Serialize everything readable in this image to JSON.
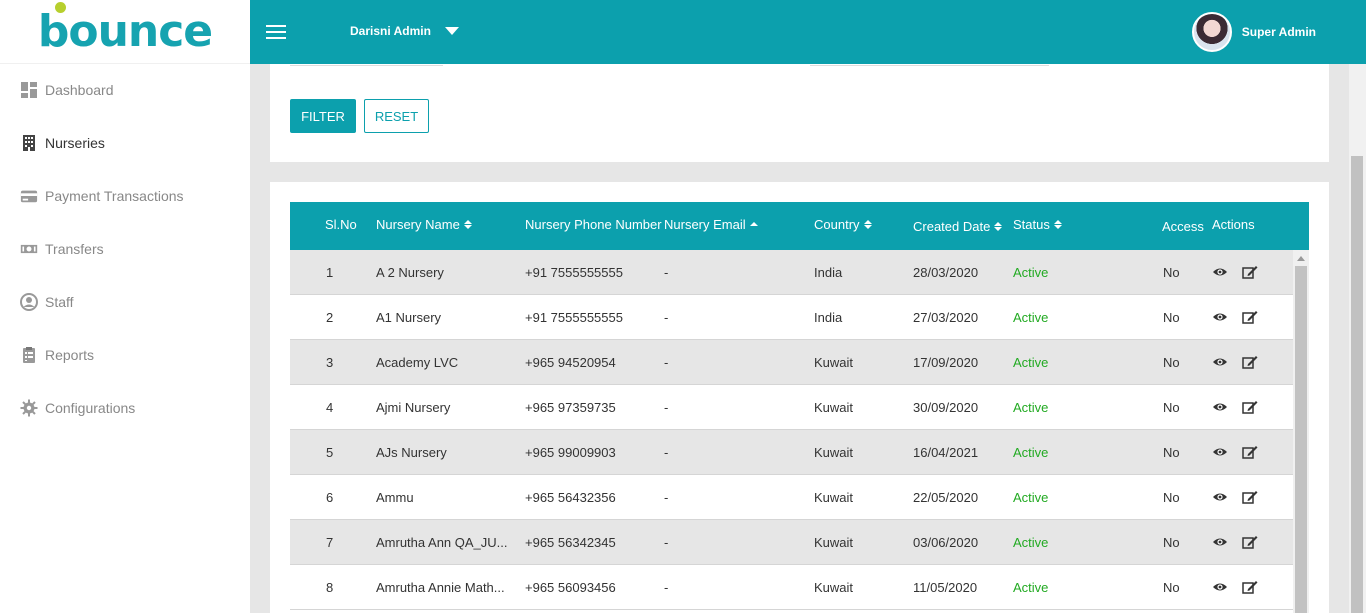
{
  "brand": {
    "logo_text": "bounce",
    "accent": "#0ca0ad",
    "logo_dot_color": "#b7cf2d"
  },
  "sidebar": {
    "items": [
      {
        "label": "Dashboard",
        "icon": "dashboard-icon"
      },
      {
        "label": "Nurseries",
        "icon": "building-icon",
        "active": true
      },
      {
        "label": "Payment Transactions",
        "icon": "credit-card-icon"
      },
      {
        "label": "Transfers",
        "icon": "money-icon"
      },
      {
        "label": "Staff",
        "icon": "user-circle-icon"
      },
      {
        "label": "Reports",
        "icon": "clipboard-icon"
      },
      {
        "label": "Configurations",
        "icon": "gear-icon"
      }
    ]
  },
  "topbar": {
    "admin_name": "Darisni Admin",
    "user_name": "Super Admin"
  },
  "filters": {
    "filter_label": "FILTER",
    "reset_label": "RESET"
  },
  "table": {
    "headers": {
      "slno": "Sl.No",
      "name": "Nursery Name",
      "phone": "Nursery Phone Number",
      "email": "Nursery Email",
      "country": "Country",
      "created": "Created Date",
      "status": "Status",
      "access": "Access",
      "actions": "Actions"
    },
    "rows": [
      {
        "slno": "1",
        "name": "A 2 Nursery",
        "phone": "+91 7555555555",
        "email": "-",
        "country": "India",
        "created": "28/03/2020",
        "status": "Active",
        "access": "No"
      },
      {
        "slno": "2",
        "name": "A1 Nursery",
        "phone": "+91 7555555555",
        "email": "-",
        "country": "India",
        "created": "27/03/2020",
        "status": "Active",
        "access": "No"
      },
      {
        "slno": "3",
        "name": "Academy LVC",
        "phone": "+965 94520954",
        "email": "-",
        "country": "Kuwait",
        "created": "17/09/2020",
        "status": "Active",
        "access": "No"
      },
      {
        "slno": "4",
        "name": "Ajmi Nursery",
        "phone": "+965 97359735",
        "email": "-",
        "country": "Kuwait",
        "created": "30/09/2020",
        "status": "Active",
        "access": "No"
      },
      {
        "slno": "5",
        "name": "AJs Nursery",
        "phone": "+965 99009903",
        "email": "-",
        "country": "Kuwait",
        "created": "16/04/2021",
        "status": "Active",
        "access": "No"
      },
      {
        "slno": "6",
        "name": "Ammu",
        "phone": "+965 56432356",
        "email": "-",
        "country": "Kuwait",
        "created": "22/05/2020",
        "status": "Active",
        "access": "No"
      },
      {
        "slno": "7",
        "name": "Amrutha Ann QA_JU...",
        "phone": "+965 56342345",
        "email": "-",
        "country": "Kuwait",
        "created": "03/06/2020",
        "status": "Active",
        "access": "No"
      },
      {
        "slno": "8",
        "name": "Amrutha Annie Math...",
        "phone": "+965 56093456",
        "email": "-",
        "country": "Kuwait",
        "created": "11/05/2020",
        "status": "Active",
        "access": "No"
      }
    ]
  }
}
